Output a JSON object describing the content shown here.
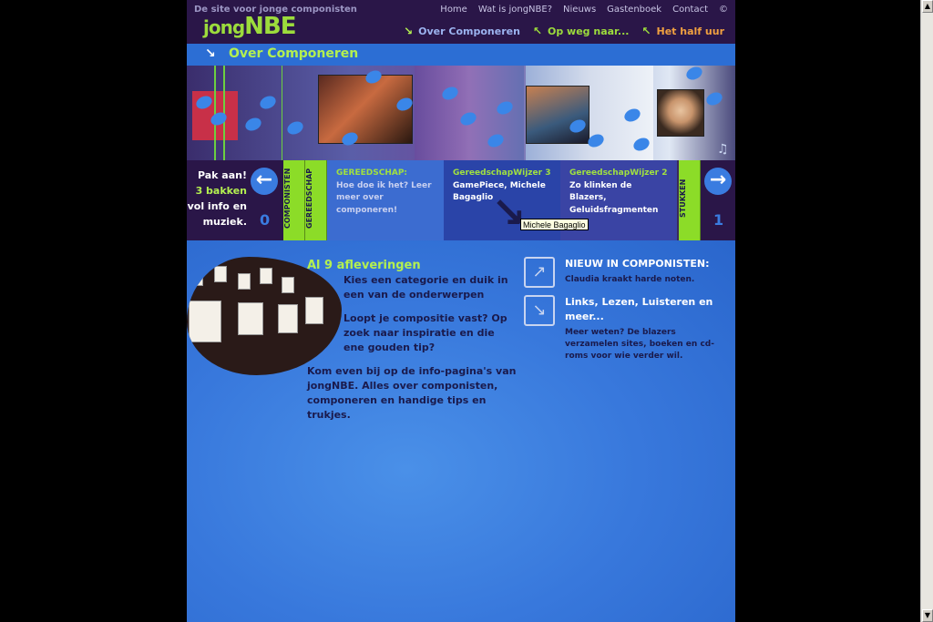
{
  "header": {
    "tagline": "De site voor jonge componisten",
    "logo_prefix": "jong",
    "logo_suffix": "NBE",
    "topnav": [
      "Home",
      "Wat is jongNBE?",
      "Nieuws",
      "Gastenboek",
      "Contact",
      "©"
    ],
    "subnav": [
      {
        "label": "Over Componeren",
        "color": "#9cb4f0",
        "arrow_color": "#b4f050"
      },
      {
        "label": "Op weg naar...",
        "color": "#9cdc3c",
        "arrow_color": "#9cdc3c"
      },
      {
        "label": "Het half uur",
        "color": "#f0a040",
        "arrow_color": "#9cdc3c"
      }
    ]
  },
  "section": {
    "title": "Over Componeren"
  },
  "navstrip": {
    "pak_aan_line1": "Pak aan!",
    "pak_aan_line2": "3 bakken",
    "pak_aan_line3": "vol info en",
    "pak_aan_line4": "muziek.",
    "prev_count": "0",
    "next_count": "1",
    "tab_componisten": "COMPONISTEN",
    "tab_gereedschap": "GEREEDSCHAP",
    "tab_stukken": "STUKKEN",
    "card1": {
      "heading": "GEREEDSCHAP:",
      "text": "Hoe doe ik het? Leer meer over componeren!"
    },
    "card2": {
      "heading": "GereedschapWijzer 3",
      "text": "GamePiece, Michele Bagaglio"
    },
    "card3": {
      "heading": "GereedschapWijzer 2",
      "text": "Zo klinken de Blazers, Geluidsfragmenten"
    },
    "tooltip": "Michele Bagaglio"
  },
  "main": {
    "title": "Al 9 afleveringen",
    "p1": "Kies een categorie en duik in een van de onderwerpen",
    "p2": "Loopt je compositie vast? Op zoek naar inspiratie en die ene gouden tip?",
    "p3": "Kom even bij op de info-pagina's van jongNBE. Alles over componisten, componeren en handige tips en trukjes."
  },
  "news": [
    {
      "icon": "arrow-up-icon",
      "head": "NIEUW IN COMPONISTEN:",
      "body": "Claudia kraakt harde noten."
    },
    {
      "icon": "arrow-down-icon",
      "head": "Links, Lezen, Luisteren en meer...",
      "body": "Meer weten? De blazers verzamelen sites, boeken en cd-roms voor wie verder wil."
    }
  ]
}
